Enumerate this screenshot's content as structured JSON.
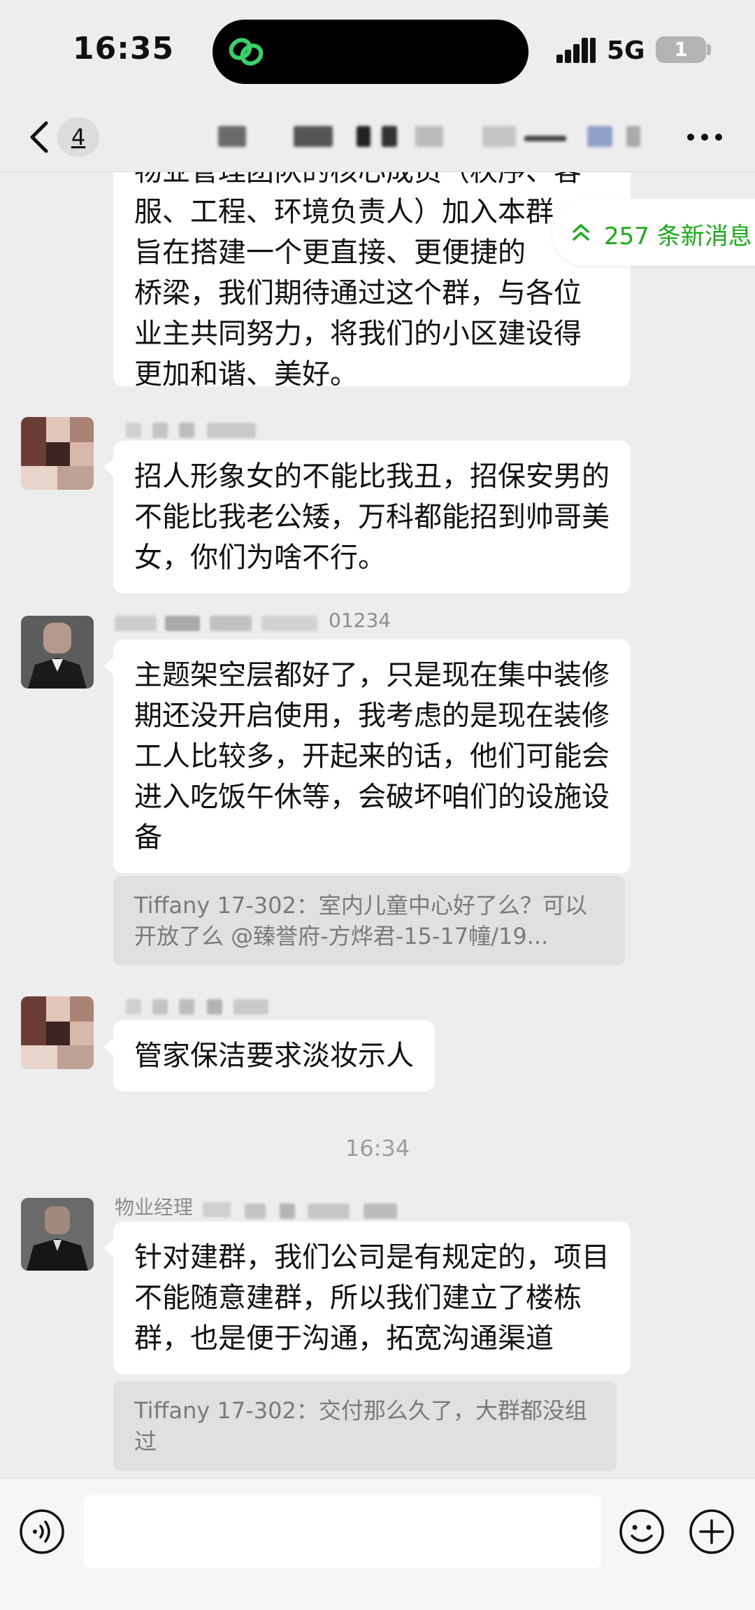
{
  "status_bar": {
    "time": "16:35",
    "network": "5G",
    "battery": "1"
  },
  "nav": {
    "unread_badge": "4"
  },
  "new_messages": "257 条新消息",
  "messages": [
    {
      "lines": [
        "物业管理团队的核心成员（秩序、客",
        "服、工程、环境负责人）加入本群，",
        "旨在搭建一个更直接、更便捷的",
        "桥梁，我们期待通过这个群，与各位",
        "业主共同努力，将我们的小区建设得",
        "更加和谐、美好。"
      ]
    },
    {
      "text": "招人形象女的不能比我丑，招保安男的不能比我老公矮，万科都能招到帅哥美女，你们为啥不行。"
    },
    {
      "sender_fragment": "01234",
      "text": "主题架空层都好了，只是现在集中装修期还没开启使用，我考虑的是现在装修工人比较多，开起来的话，他们可能会进入吃饭午休等，会破坏咱们的设施设备",
      "quote": "Tiffany 17-302：室内儿童中心好了么？可以开放了么 @臻誉府-方烨君-15-17幢/19..."
    },
    {
      "text": "管家保洁要求淡妆示人"
    },
    {
      "sender_fragment": "物业经理",
      "text": "针对建群，我们公司是有规定的，项目不能随意建群，所以我们建立了楼栋群，也是便于沟通，拓宽沟通渠道",
      "quote": "Tiffany 17-302：交付那么久了，大群都没组过"
    }
  ],
  "timestamp": "16:34",
  "input": {
    "value": ""
  },
  "icons": [
    "signal-icon",
    "back-chevron-icon",
    "more-icon",
    "double-chevron-up-icon",
    "voice-icon",
    "emoji-icon",
    "plus-icon"
  ]
}
